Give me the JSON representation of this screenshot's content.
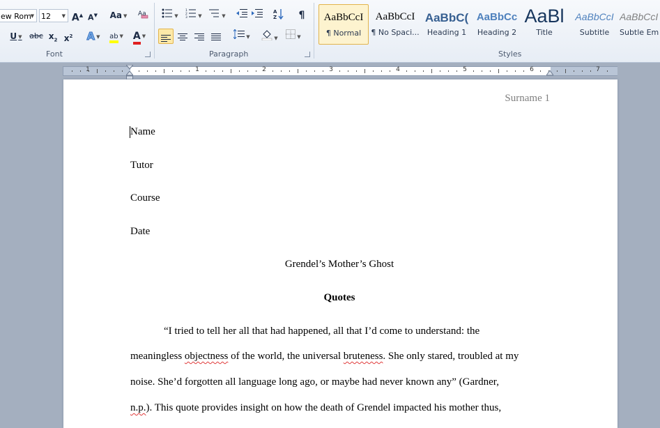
{
  "ribbon": {
    "font": {
      "label": "Font",
      "font_name": "ew Rom",
      "font_size": "12",
      "grow_glyph": "A",
      "shrink_glyph": "A",
      "case_glyph": "Aa",
      "underline_glyph": "U",
      "strike_glyph": "abc",
      "subscript_glyph": "x",
      "subscript_mark": "2",
      "superscript_glyph": "x",
      "superscript_mark": "2",
      "effects_glyph": "A",
      "highlight_glyph": "ab",
      "font_color_glyph": "A",
      "highlight_color": "#ffff00",
      "font_color": "#e02020"
    },
    "paragraph": {
      "label": "Paragraph",
      "pilcrow_glyph": "¶"
    },
    "styles": {
      "label": "Styles",
      "items": [
        {
          "sample": "AaBbCcI",
          "name": "¶ Normal"
        },
        {
          "sample": "AaBbCcI",
          "name": "¶ No Spaci..."
        },
        {
          "sample": "AaBbC(",
          "name": "Heading 1"
        },
        {
          "sample": "AaBbCc",
          "name": "Heading 2"
        },
        {
          "sample": "AaBl",
          "name": "Title"
        },
        {
          "sample": "AaBbCcI",
          "name": "Subtitle"
        },
        {
          "sample": "AaBbCcI",
          "name": "Subtle Em"
        }
      ]
    }
  },
  "ruler": {
    "numbers": [
      "1",
      "1",
      "2",
      "3",
      "4",
      "5",
      "6",
      "7"
    ]
  },
  "document": {
    "header": "Surname 1",
    "lines": [
      "Name",
      "Tutor",
      "Course",
      "Date"
    ],
    "title": "Grendel’s Mother’s Ghost",
    "heading": "Quotes",
    "para": {
      "l1": "“I tried to tell her all that had happened, all that I’d come to understand: the",
      "l2a": "meaningless ",
      "l2b": "objectness",
      "l2c": " of the world, the universal ",
      "l2d": "bruteness",
      "l2e": ". She only stared, troubled at my",
      "l3": "noise. She’d forgotten all language long ago, or maybe had never known any” (Gardner,",
      "l4a": "n.p.",
      "l4b": "). This quote provides insight on how the death of Grendel impacted his mother thus,"
    }
  }
}
